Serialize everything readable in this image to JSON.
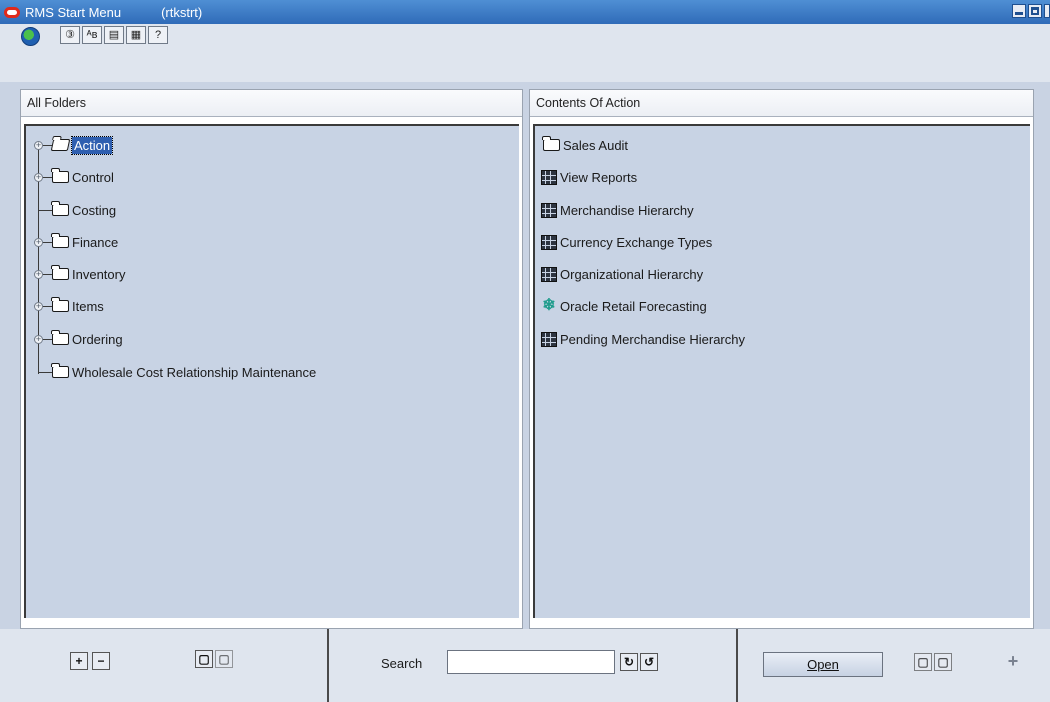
{
  "window": {
    "title": "RMS Start Menu",
    "module": "(rtkstrt)"
  },
  "toolbar": {
    "buttons": [
      {
        "icon": "help-icon",
        "glyph": "③"
      },
      {
        "icon": "abbreviation-icon",
        "glyph": "ᴬʙ"
      },
      {
        "icon": "document-icon",
        "glyph": "▤"
      },
      {
        "icon": "calendar-icon",
        "glyph": "▦"
      },
      {
        "icon": "question-icon",
        "glyph": "?"
      }
    ]
  },
  "left_panel": {
    "header": "All Folders",
    "folders": [
      {
        "label": "Action",
        "expandable": true,
        "selected": true
      },
      {
        "label": "Control",
        "expandable": true
      },
      {
        "label": "Costing",
        "expandable": false
      },
      {
        "label": "Finance",
        "expandable": true
      },
      {
        "label": "Inventory",
        "expandable": true
      },
      {
        "label": "Items",
        "expandable": true
      },
      {
        "label": "Ordering",
        "expandable": true
      },
      {
        "label": "Wholesale Cost Relationship Maintenance",
        "expandable": false
      }
    ]
  },
  "right_panel": {
    "header": "Contents Of Action",
    "items": [
      {
        "label": "Sales Audit",
        "icon": "folder-icon"
      },
      {
        "label": "View Reports",
        "icon": "report-icon"
      },
      {
        "label": "Merchandise Hierarchy",
        "icon": "report-icon"
      },
      {
        "label": "Currency Exchange Types",
        "icon": "report-icon"
      },
      {
        "label": "Organizational Hierarchy",
        "icon": "report-icon"
      },
      {
        "label": "Oracle Retail Forecasting",
        "icon": "forecast-icon"
      },
      {
        "label": "Pending Merchandise Hierarchy",
        "icon": "report-icon"
      }
    ]
  },
  "bottom": {
    "search_label": "Search",
    "search_value": "",
    "open_label": "Open"
  },
  "colors": {
    "titlebar": "#2f6bb8",
    "panel_bg": "#c8d3e4",
    "selection": "#2f5fb0"
  }
}
